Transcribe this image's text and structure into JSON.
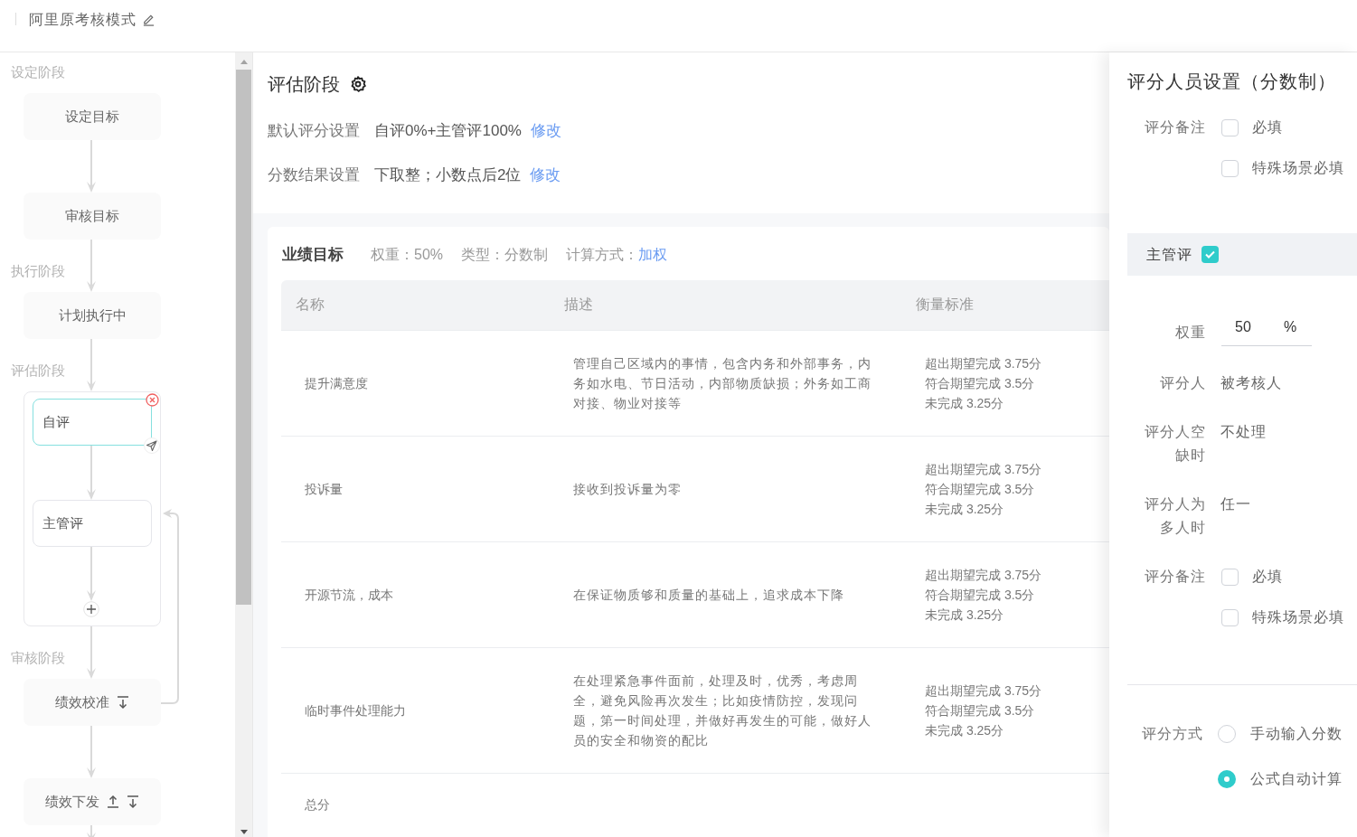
{
  "header": {
    "title": "阿里原考核模式"
  },
  "flow": [
    {
      "kind": "node",
      "stage": "设定阶段",
      "label": "设定目标",
      "move_up": false,
      "move_down": false
    },
    {
      "kind": "node",
      "label": "审核目标",
      "move_up": false,
      "move_down": false
    },
    {
      "kind": "node",
      "stage": "执行阶段",
      "label": "计划执行中",
      "move_up": false,
      "move_down": false
    },
    {
      "kind": "group",
      "stage": "评估阶段",
      "children": [
        {
          "label": "自评",
          "selected": true
        },
        {
          "label": "主管评",
          "selected": false
        }
      ]
    },
    {
      "kind": "node",
      "stage": "审核阶段",
      "label": "绩效校准",
      "move_up": false,
      "move_down": true,
      "loops_back": true
    },
    {
      "kind": "node",
      "label": "绩效下发",
      "move_up": true,
      "move_down": true
    }
  ],
  "main": {
    "title": "评估阶段",
    "settings": [
      {
        "label": "默认评分设置",
        "value": "自评0%+主管评100%",
        "link": "修改"
      },
      {
        "label": "分数结果设置",
        "value": "下取整；小数点后2位",
        "link": "修改"
      }
    ],
    "card": {
      "title": "业绩目标",
      "meta": [
        {
          "label": "权重：",
          "value": "50%",
          "kind": "text"
        },
        {
          "label": "类型：",
          "value": "分数制",
          "kind": "text"
        },
        {
          "label": "计算方式：",
          "value": "加权",
          "kind": "link"
        }
      ],
      "columns": [
        "名称",
        "描述",
        "衡量标准"
      ],
      "rows": [
        {
          "name": "提升满意度",
          "description": "管理自己区域内的事情，包含内务和外部事务，内务如水电、节日活动，内部物质缺损；外务如工商对接、物业对接等",
          "criteria": [
            "超出期望完成 3.75分",
            "符合期望完成 3.5分",
            "未完成 3.25分"
          ]
        },
        {
          "name": "投诉量",
          "description": "接收到投诉量为零",
          "criteria": [
            "超出期望完成 3.75分",
            "符合期望完成 3.5分",
            "未完成 3.25分"
          ]
        },
        {
          "name": "开源节流，成本",
          "description": "在保证物质够和质量的基础上，追求成本下降",
          "criteria": [
            "超出期望完成 3.75分",
            "符合期望完成 3.5分",
            "未完成 3.25分"
          ]
        },
        {
          "name": "临时事件处理能力",
          "description": "在处理紧急事件面前，处理及时，优秀，考虑周全，避免风险再次发生；比如疫情防控，发现问题，第一时间处理，并做好再发生的可能，做好人员的安全和物资的配比",
          "criteria": [
            "超出期望完成 3.75分",
            "符合期望完成 3.5分",
            "未完成 3.25分"
          ]
        }
      ],
      "total_label": "总分"
    }
  },
  "panel": {
    "title": "评分人员设置（分数制）",
    "self_remark": {
      "label": "评分备注",
      "options": [
        {
          "label": "必填",
          "checked": false
        },
        {
          "label": "特殊场景必填",
          "checked": false
        }
      ]
    },
    "section": {
      "label": "主管评",
      "checked": true
    },
    "weight": {
      "label": "权重",
      "value": "50",
      "unit": "%"
    },
    "fields": [
      {
        "label": "评分人",
        "value": "被考核人"
      },
      {
        "label": "评分人空缺时",
        "value": "不处理"
      },
      {
        "label": "评分人为多人时",
        "value": "任一"
      }
    ],
    "remark": {
      "label": "评分备注",
      "options": [
        {
          "label": "必填",
          "checked": false
        },
        {
          "label": "特殊场景必填",
          "checked": false
        }
      ]
    },
    "method": {
      "label": "评分方式",
      "options": [
        {
          "label": "手动输入分数",
          "selected": false
        },
        {
          "label": "公式自动计算",
          "selected": true
        }
      ]
    }
  }
}
